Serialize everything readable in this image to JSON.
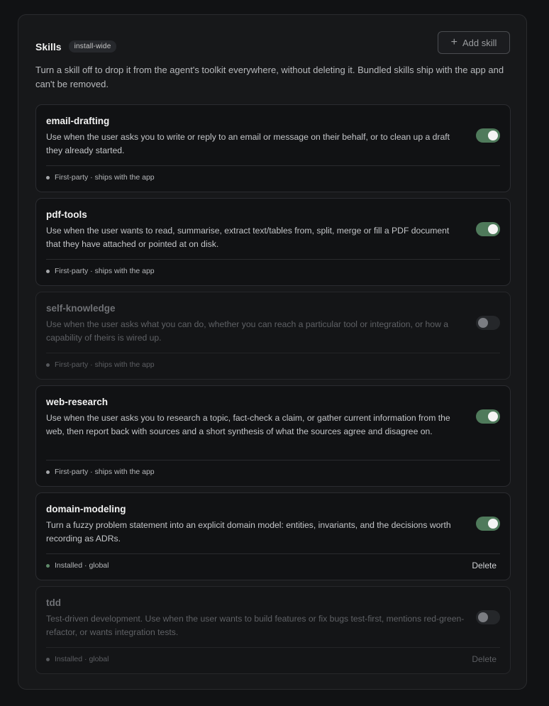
{
  "header": {
    "title": "Skills",
    "badge": "install-wide",
    "add_button": "Add skill",
    "add_icon": "plus-icon",
    "description": "Turn a skill off to drop it from the agent's toolkit everywhere, without deleting it. Bundled skills ship with the app and can't be removed."
  },
  "colors": {
    "toggle_on": "#4f7a5b",
    "installed_dot": "#5f8a6a",
    "background": "#111214"
  },
  "skills": [
    {
      "name": "email-drafting",
      "description": "Use when the user asks you to write or reply to an email or message on their behalf, or to clean up a draft they already started.",
      "enabled": true,
      "source": "First-party · ships with the app"
    },
    {
      "name": "pdf-tools",
      "description": "Use when the user wants to read, summarise, extract text/tables from, split, merge or fill a PDF document that they have attached or pointed at on disk.",
      "enabled": true,
      "source": "First-party · ships with the app"
    },
    {
      "name": "self-knowledge",
      "description": "Use when the user asks what you can do, whether you can reach a particular tool or integration, or how a capability of theirs is wired up.",
      "enabled": false,
      "source": "First-party · ships with the app"
    },
    {
      "name": "web-research",
      "description": "Use when the user asks you to research a topic, fact-check a claim, or gather current information from the web, then report back with sources and a short synthesis of what the sources agree and disagree on.",
      "enabled": true,
      "source": "First-party · ships with the app"
    },
    {
      "name": "domain-modeling",
      "description": "Turn a fuzzy problem statement into an explicit domain model: entities, invariants, and the decisions worth recording as ADRs.",
      "enabled": true,
      "source": "Installed · global",
      "delete_label": "Delete"
    },
    {
      "name": "tdd",
      "description": "Test-driven development. Use when the user wants to build features or fix bugs test-first, mentions red-green-refactor, or wants integration tests.",
      "enabled": false,
      "source": "Installed · global",
      "delete_label": "Delete"
    }
  ]
}
